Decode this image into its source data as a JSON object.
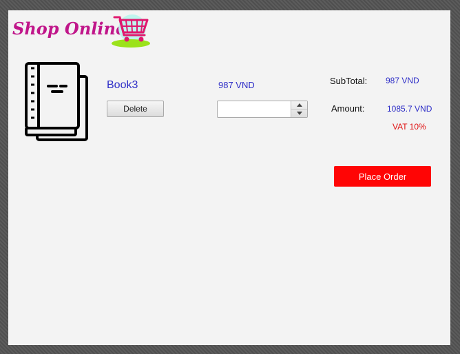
{
  "header": {
    "logo_text": "Shop Online",
    "logo_icon": "shopping-cart-icon"
  },
  "cart_item": {
    "icon": "book-icon",
    "name": "Book3",
    "price": "987 VND",
    "delete_label": "Delete",
    "quantity_value": ""
  },
  "summary": {
    "subtotal_label": "SubTotal:",
    "subtotal_value": "987 VND",
    "amount_label": "Amount:",
    "amount_value": "1085.7 VND",
    "vat_note": "VAT 10%"
  },
  "actions": {
    "place_order_label": "Place Order"
  },
  "colors": {
    "accent_blue": "#2d2dc7",
    "brand_pink": "#c0168a",
    "order_red": "#ff0505",
    "vat_red": "#e01010"
  }
}
